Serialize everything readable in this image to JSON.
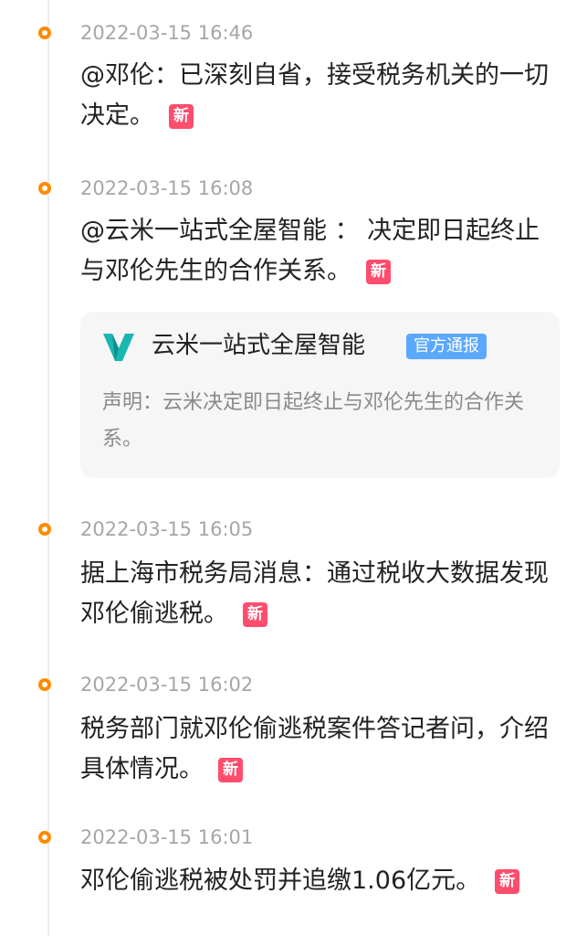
{
  "events": [
    {
      "time": "2022-03-15 16:46",
      "text": "@邓伦：已深刻自省，接受税务机关的一切决定。",
      "badge": "新"
    },
    {
      "time": "2022-03-15 16:08",
      "text": "@云米一站式全屋智能 ： 决定即日起终止与邓伦先生的合作关系。",
      "badge": "新",
      "card": {
        "account_name": "云米一站式全屋智能",
        "official_badge": "官方通报",
        "statement": "声明：云米决定即日起终止与邓伦先生的合作关系。",
        "logo_icon": "yunmi-logo-icon"
      }
    },
    {
      "time": "2022-03-15 16:05",
      "text": "据上海市税务局消息：通过税收大数据发现邓伦偷逃税。",
      "badge": "新"
    },
    {
      "time": "2022-03-15 16:02",
      "text": "税务部门就邓伦偷逃税案件答记者问，介绍具体情况。",
      "badge": "新"
    },
    {
      "time": "2022-03-15 16:01",
      "text": "邓伦偷逃税被处罚并追缴1.06亿元。",
      "badge": "新"
    }
  ],
  "colors": {
    "timeline_dot": "#ff8a00",
    "new_badge": "#ff4d6d",
    "official_badge": "#5aa8ff",
    "logo": "#19b7b2"
  }
}
